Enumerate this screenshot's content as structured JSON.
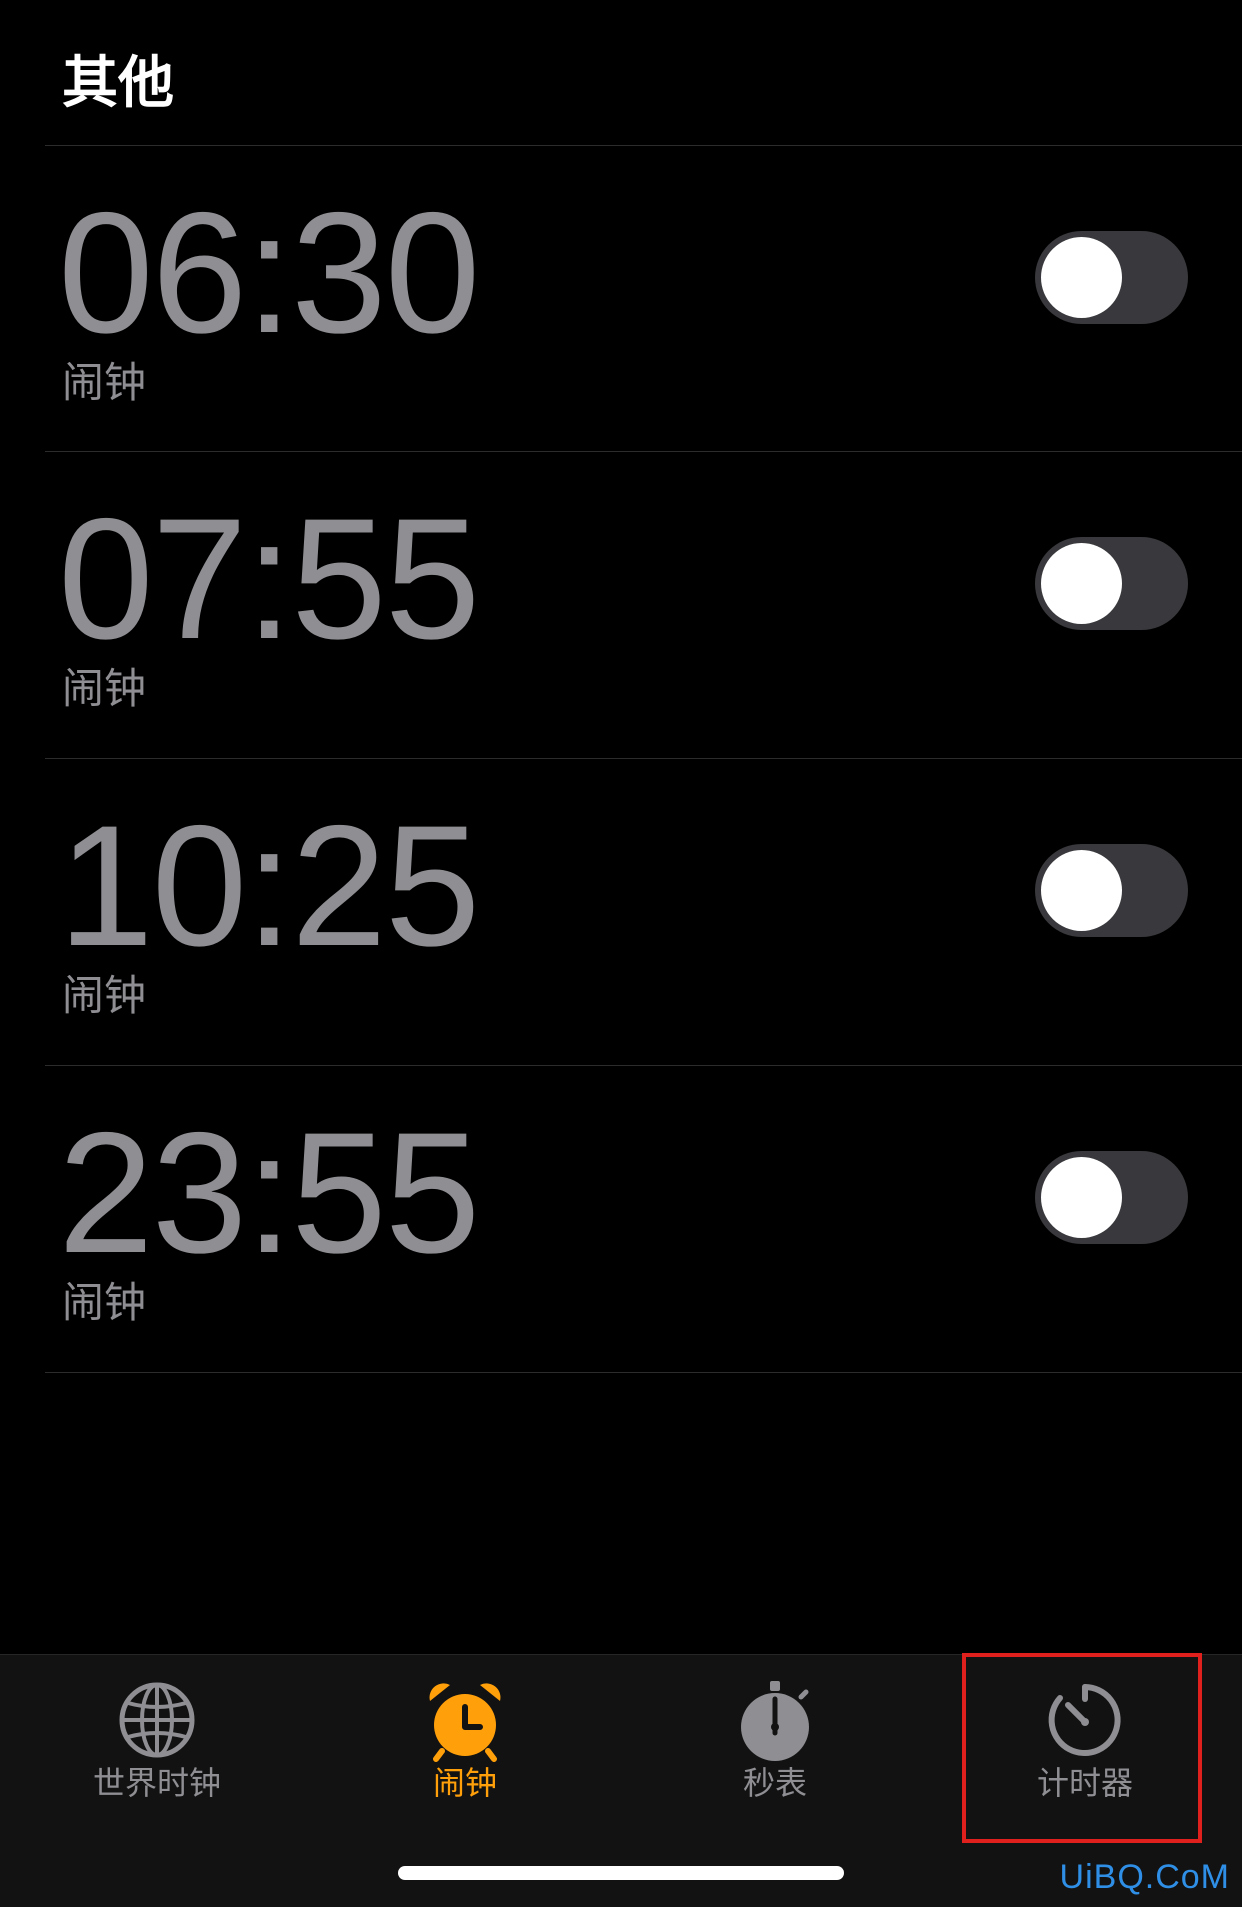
{
  "section": {
    "title": "其他"
  },
  "alarms": [
    {
      "time": "06:30",
      "label": "闹钟",
      "enabled": false
    },
    {
      "time": "07:55",
      "label": "闹钟",
      "enabled": false
    },
    {
      "time": "10:25",
      "label": "闹钟",
      "enabled": false
    },
    {
      "time": "23:55",
      "label": "闹钟",
      "enabled": false
    }
  ],
  "tab_bar": {
    "tabs": [
      {
        "label": "世界时钟",
        "icon": "globe-icon",
        "active": false
      },
      {
        "label": "闹钟",
        "icon": "alarm-clock-icon",
        "active": true
      },
      {
        "label": "秒表",
        "icon": "stopwatch-icon",
        "active": false
      },
      {
        "label": "计时器",
        "icon": "timer-icon",
        "active": false
      }
    ]
  },
  "watermark": "UiBQ.CoM",
  "colors": {
    "background": "#000000",
    "time_text": "#8e8e93",
    "accent": "#ff9f0a",
    "toggle_off": "#39393d",
    "highlight": "#e0201c"
  }
}
